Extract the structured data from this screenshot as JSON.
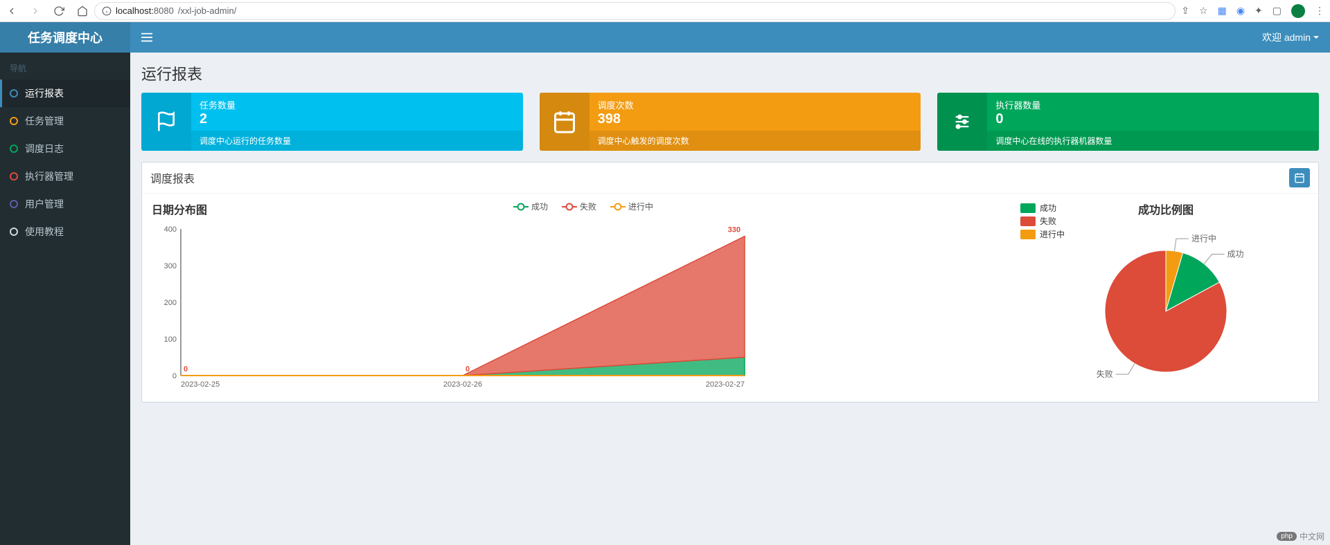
{
  "browser": {
    "url_prefix": "localhost:",
    "url_port": "8080",
    "url_path": "/xxl-job-admin/"
  },
  "header": {
    "logo": "任务调度中心",
    "welcome": "欢迎 admin"
  },
  "sidebar": {
    "section": "导航",
    "items": [
      {
        "label": "运行报表",
        "dot": "dot-blue",
        "active": true
      },
      {
        "label": "任务管理",
        "dot": "dot-orange"
      },
      {
        "label": "调度日志",
        "dot": "dot-green"
      },
      {
        "label": "执行器管理",
        "dot": "dot-red"
      },
      {
        "label": "用户管理",
        "dot": "dot-purple"
      },
      {
        "label": "使用教程",
        "dot": "dot-gray"
      }
    ]
  },
  "page_title": "运行报表",
  "info_boxes": [
    {
      "label": "任务数量",
      "value": "2",
      "desc": "调度中心运行的任务数量",
      "color": "blue"
    },
    {
      "label": "调度次数",
      "value": "398",
      "desc": "调度中心触发的调度次数",
      "color": "orange"
    },
    {
      "label": "执行器数量",
      "value": "0",
      "desc": "调度中心在线的执行器机器数量",
      "color": "green"
    }
  ],
  "panel": {
    "title": "调度报表",
    "line_title": "日期分布图",
    "pie_title": "成功比例图",
    "legend": {
      "success": "成功",
      "fail": "失败",
      "running": "进行中"
    }
  },
  "chart_data": [
    {
      "type": "area",
      "title": "日期分布图",
      "x": [
        "2023-02-25",
        "2023-02-26",
        "2023-02-27"
      ],
      "series": [
        {
          "name": "成功",
          "values": [
            0,
            0,
            50
          ],
          "color": "#00a65a"
        },
        {
          "name": "失败",
          "values": [
            0,
            0,
            330
          ],
          "color": "#dd4b39"
        },
        {
          "name": "进行中",
          "values": [
            0,
            0,
            0
          ],
          "color": "#f39c12"
        }
      ],
      "ylim": [
        0,
        400
      ],
      "yticks": [
        0,
        100,
        200,
        300,
        400
      ],
      "data_labels": [
        {
          "x": "2023-02-25",
          "value": 0,
          "color": "#dd4b39"
        },
        {
          "x": "2023-02-26",
          "value": 0,
          "color": "#dd4b39"
        },
        {
          "x": "2023-02-27",
          "value": 330,
          "color": "#dd4b39"
        }
      ]
    },
    {
      "type": "pie",
      "title": "成功比例图",
      "slices": [
        {
          "name": "成功",
          "value": 50,
          "color": "#00a65a"
        },
        {
          "name": "失败",
          "value": 330,
          "color": "#dd4b39"
        },
        {
          "name": "进行中",
          "value": 18,
          "color": "#f39c12"
        }
      ]
    }
  ],
  "watermark": {
    "badge": "php",
    "text": "中文网"
  }
}
